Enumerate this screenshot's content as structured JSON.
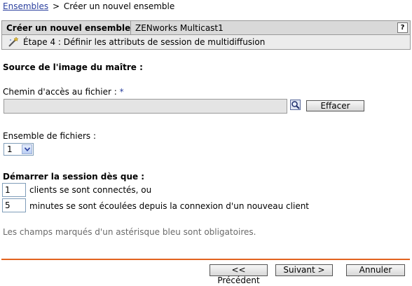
{
  "breadcrumb": {
    "root": "Ensembles",
    "separator": ">",
    "current": "Créer un nouvel ensemble"
  },
  "header": {
    "title": "Créer un nouvel ensemble",
    "object": "ZENworks Multicast1",
    "help": "?",
    "step": "Étape 4 : Définir les attributs de session de multidiffusion"
  },
  "form": {
    "source_heading": "Source de l'image du maître :",
    "path_label": "Chemin d'accès au fichier : ",
    "required_marker": "*",
    "path_value": "",
    "clear_label": "Effacer",
    "fileset_label": "Ensemble de fichiers :",
    "fileset_value": "1",
    "start_heading": "Démarrer la session dès que :",
    "clients_value": "1",
    "clients_label": "clients se sont connectés, ou",
    "minutes_value": "5",
    "minutes_label": "minutes se sont écoulées depuis la connexion d'un nouveau client",
    "required_note": "Les champs marqués d'un astérisque bleu sont obligatoires."
  },
  "footer": {
    "previous": "<< Précédent",
    "next": "Suivant >",
    "cancel": "Annuler"
  },
  "colors": {
    "accent": "#e2631f",
    "link": "#2a3f9e",
    "header_bg": "#d9d9d9"
  },
  "icons": [
    "wizard-wand-icon",
    "browse-icon",
    "chevron-down-icon"
  ]
}
